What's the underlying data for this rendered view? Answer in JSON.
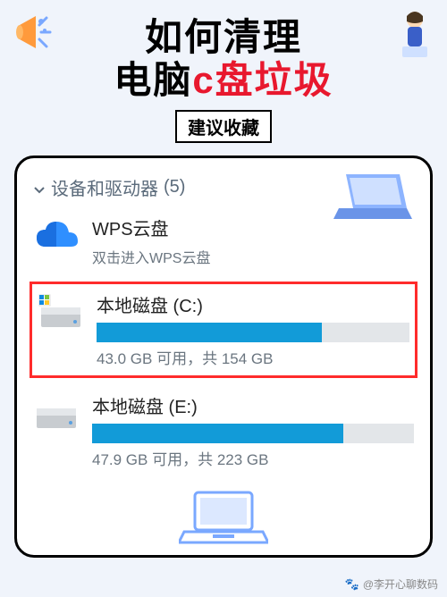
{
  "title": {
    "line1": "如何清理",
    "line2_prefix": "电脑",
    "line2_red": "c盘垃圾"
  },
  "badge": "建议收藏",
  "section": {
    "label": "设备和驱动器",
    "count": "(5)"
  },
  "drives": [
    {
      "name": "WPS云盘",
      "subtitle": "双击进入WPS云盘",
      "type": "cloud"
    },
    {
      "name": "本地磁盘 (C:)",
      "stats": "43.0 GB 可用，共 154 GB",
      "fill_percent": 72,
      "type": "disk",
      "highlight": true
    },
    {
      "name": "本地磁盘 (E:)",
      "stats": "47.9 GB 可用，共 223 GB",
      "fill_percent": 78,
      "type": "disk"
    }
  ],
  "footer": {
    "author": "@李开心聊数码"
  }
}
